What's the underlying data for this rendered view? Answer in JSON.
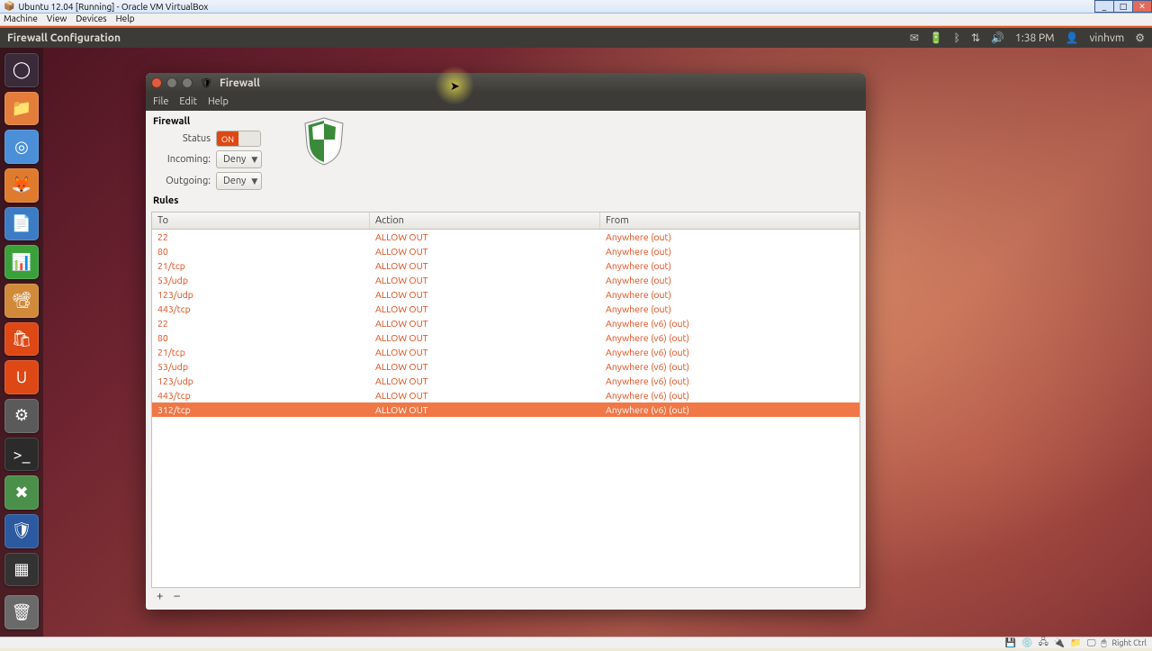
{
  "vbox": {
    "title": "Ubuntu 12.04 [Running] - Oracle VM VirtualBox",
    "menu": [
      "Machine",
      "View",
      "Devices",
      "Help"
    ],
    "status_mod": "Right Ctrl"
  },
  "topbar": {
    "app_title": "Firewall Configuration",
    "time": "1:38 PM",
    "user": "vinhvm"
  },
  "launcher": {
    "items": [
      {
        "name": "dash",
        "bg": "#3a2a3a",
        "glyph": "◯"
      },
      {
        "name": "files",
        "bg": "#e47d3b",
        "glyph": "📁"
      },
      {
        "name": "chromium",
        "bg": "#4a8fd8",
        "glyph": "◎"
      },
      {
        "name": "firefox",
        "bg": "#e07b2e",
        "glyph": "🦊"
      },
      {
        "name": "writer",
        "bg": "#3d7bc4",
        "glyph": "📄"
      },
      {
        "name": "calc",
        "bg": "#3aa13a",
        "glyph": "📊"
      },
      {
        "name": "impress",
        "bg": "#d08a3a",
        "glyph": "📽"
      },
      {
        "name": "ubuntu-sw",
        "bg": "#dd4814",
        "glyph": "🛍"
      },
      {
        "name": "ubuntu-one",
        "bg": "#dd4814",
        "glyph": "U"
      },
      {
        "name": "settings",
        "bg": "#5a5a5a",
        "glyph": "⚙"
      },
      {
        "name": "terminal",
        "bg": "#2b2b2b",
        "glyph": ">_"
      },
      {
        "name": "synaptic",
        "bg": "#4a8f4a",
        "glyph": "✖"
      },
      {
        "name": "gufw",
        "bg": "#2c5aa0",
        "glyph": "🛡"
      },
      {
        "name": "workspace",
        "bg": "#333",
        "glyph": "▦"
      }
    ],
    "trash": {
      "name": "trash",
      "bg": "#6a6a6a",
      "glyph": "🗑"
    }
  },
  "window": {
    "title": "Firewall",
    "menu": [
      "File",
      "Edit",
      "Help"
    ],
    "section_firewall": "Firewall",
    "section_rules": "Rules",
    "status_label": "Status",
    "status_value": "ON",
    "incoming_label": "Incoming:",
    "incoming_value": "Deny",
    "outgoing_label": "Outgoing:",
    "outgoing_value": "Deny",
    "columns": {
      "to": "To",
      "action": "Action",
      "from": "From"
    },
    "rules": [
      {
        "to": "22",
        "action": "ALLOW OUT",
        "from": "Anywhere (out)"
      },
      {
        "to": "80",
        "action": "ALLOW OUT",
        "from": "Anywhere (out)"
      },
      {
        "to": "21/tcp",
        "action": "ALLOW OUT",
        "from": "Anywhere (out)"
      },
      {
        "to": "53/udp",
        "action": "ALLOW OUT",
        "from": "Anywhere (out)"
      },
      {
        "to": "123/udp",
        "action": "ALLOW OUT",
        "from": "Anywhere (out)"
      },
      {
        "to": "443/tcp",
        "action": "ALLOW OUT",
        "from": "Anywhere (out)"
      },
      {
        "to": "22",
        "action": "ALLOW OUT",
        "from": "Anywhere (v6) (out)"
      },
      {
        "to": "80",
        "action": "ALLOW OUT",
        "from": "Anywhere (v6) (out)"
      },
      {
        "to": "21/tcp",
        "action": "ALLOW OUT",
        "from": "Anywhere (v6) (out)"
      },
      {
        "to": "53/udp",
        "action": "ALLOW OUT",
        "from": "Anywhere (v6) (out)"
      },
      {
        "to": "123/udp",
        "action": "ALLOW OUT",
        "from": "Anywhere (v6) (out)"
      },
      {
        "to": "443/tcp",
        "action": "ALLOW OUT",
        "from": "Anywhere (v6) (out)"
      },
      {
        "to": "312/tcp",
        "action": "ALLOW OUT",
        "from": "Anywhere (v6) (out)"
      }
    ],
    "selected_index": 12,
    "add_label": "+",
    "remove_label": "–"
  }
}
